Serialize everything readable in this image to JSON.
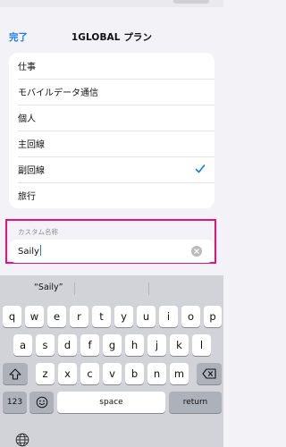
{
  "nav": {
    "done_label": "完了",
    "title": "1GLOBAL プラン"
  },
  "list": {
    "items": [
      {
        "label": "仕事",
        "selected": false
      },
      {
        "label": "モバイルデータ通信",
        "selected": false
      },
      {
        "label": "個人",
        "selected": false
      },
      {
        "label": "主回線",
        "selected": false
      },
      {
        "label": "副回線",
        "selected": true
      },
      {
        "label": "旅行",
        "selected": false
      }
    ]
  },
  "custom_name": {
    "label": "カスタム名称",
    "value": "Saily"
  },
  "keyboard": {
    "suggestion": "“Saily”",
    "row1": [
      "q",
      "w",
      "e",
      "r",
      "t",
      "y",
      "u",
      "i",
      "o",
      "p"
    ],
    "row2": [
      "a",
      "s",
      "d",
      "f",
      "g",
      "h",
      "j",
      "k",
      "l"
    ],
    "row3": [
      "z",
      "x",
      "c",
      "v",
      "b",
      "n",
      "m"
    ],
    "numbers_label": "123",
    "space_label": "space",
    "return_label": "return"
  },
  "colors": {
    "accent": "#1b7cf5",
    "highlight_border": "#e8127a",
    "background": "#f2f2f7",
    "keyboard_bg": "#d1d3d9"
  },
  "icons": {
    "checkmark": "checkmark-icon",
    "clear": "clear-text-icon",
    "shift": "shift-icon",
    "delete": "delete-backspace-icon",
    "emoji": "emoji-icon",
    "globe": "globe-icon"
  }
}
